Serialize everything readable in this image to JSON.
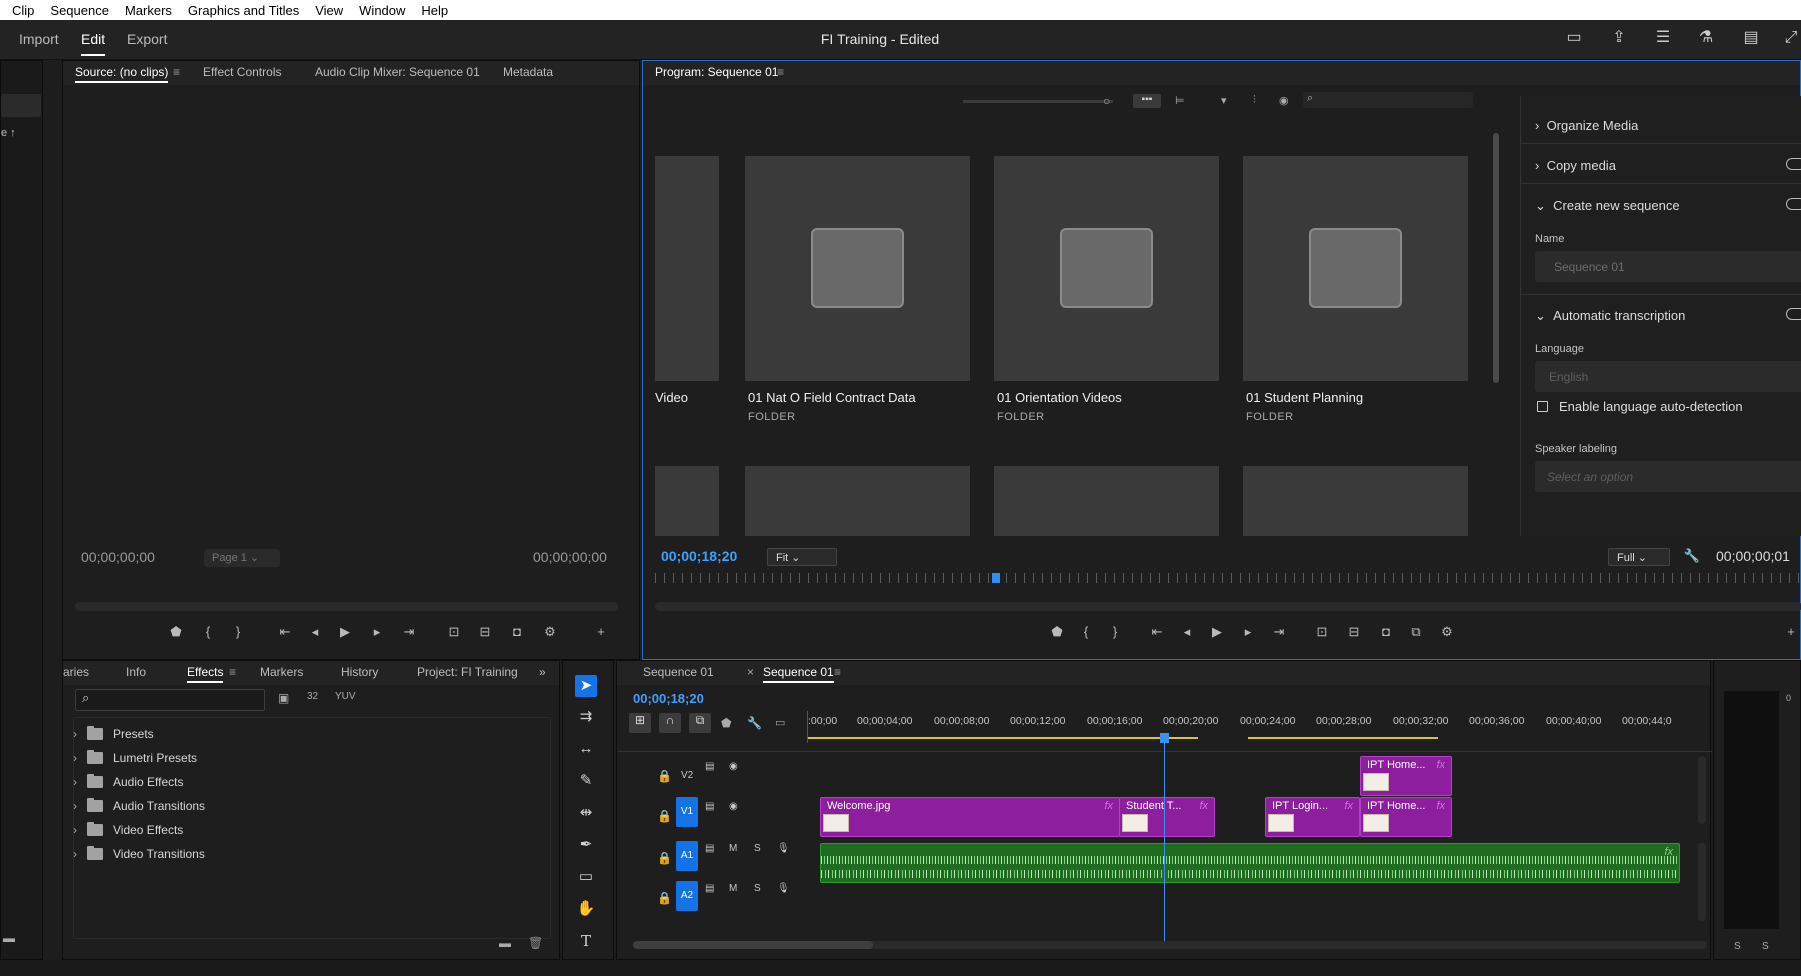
{
  "menu": [
    "Clip",
    "Sequence",
    "Markers",
    "Graphics and Titles",
    "View",
    "Window",
    "Help"
  ],
  "workspaces": {
    "import": "Import",
    "edit": "Edit",
    "export": "Export"
  },
  "app_title": "FI Training - Edited",
  "source_panel": {
    "tabs": [
      "Source: (no clips)",
      "Effect Controls",
      "Audio Clip Mixer: Sequence 01",
      "Metadata"
    ],
    "timecode_left": "00;00;00;00",
    "timecode_right": "00;00;00;00",
    "page_label": "Page 1"
  },
  "program_panel": {
    "tab": "Program: Sequence 01",
    "timecode": "00;00;18;20",
    "fit": "Fit",
    "quality": "Full",
    "duration": "00;00;00;01"
  },
  "media_browser": {
    "partial_label": "Video",
    "folders": [
      {
        "name": "01 Nat O Field Contract Data",
        "type": "FOLDER"
      },
      {
        "name": "01 Orientation Videos",
        "type": "FOLDER"
      },
      {
        "name": "01 Student Planning",
        "type": "FOLDER"
      }
    ]
  },
  "create_panel": {
    "organize_media": "Organize Media",
    "copy_media": "Copy media",
    "create_sequence": "Create new sequence",
    "name_label": "Name",
    "name_value": "Sequence 01",
    "auto_transcription": "Automatic transcription",
    "language_label": "Language",
    "language_value": "English",
    "auto_detect": "Enable language auto-detection",
    "speaker_label": "Speaker labeling",
    "speaker_value": "Select an option"
  },
  "effects_panel": {
    "tabs": [
      "aries",
      "Info",
      "Effects",
      "Markers",
      "History",
      "Project: FI Training"
    ],
    "items": [
      "Presets",
      "Lumetri Presets",
      "Audio Effects",
      "Audio Transitions",
      "Video Effects",
      "Video Transitions"
    ]
  },
  "timeline": {
    "tabs": [
      "Sequence 01",
      "Sequence 01"
    ],
    "timecode": "00;00;18;20",
    "ruler": [
      ":00;00",
      "00;00;04;00",
      "00;00;08;00",
      "00;00;12;00",
      "00;00;16;00",
      "00;00;20;00",
      "00;00;24;00",
      "00;00;28;00",
      "00;00;32;00",
      "00;00;36;00",
      "00;00;40;00",
      "00;00;44;0"
    ],
    "tracks": {
      "v2": "V2",
      "v1": "V1",
      "a1": "A1",
      "a2": "A2"
    },
    "clips": {
      "welcome": "Welcome.jpg",
      "student": "Student T...",
      "ipt_login": "IPT Login...",
      "ipt_home1": "IPT Home...",
      "ipt_home2": "IPT Home..."
    },
    "fx": "fx",
    "m": "M",
    "s": "S"
  },
  "meter": {
    "s1": "S",
    "s2": "S",
    "zero": "0"
  },
  "colors": {
    "accent": "#1473e6",
    "timecode": "#3da1ff",
    "video_clip": "#8d1f9f",
    "audio_clip": "#1f7a1f"
  }
}
